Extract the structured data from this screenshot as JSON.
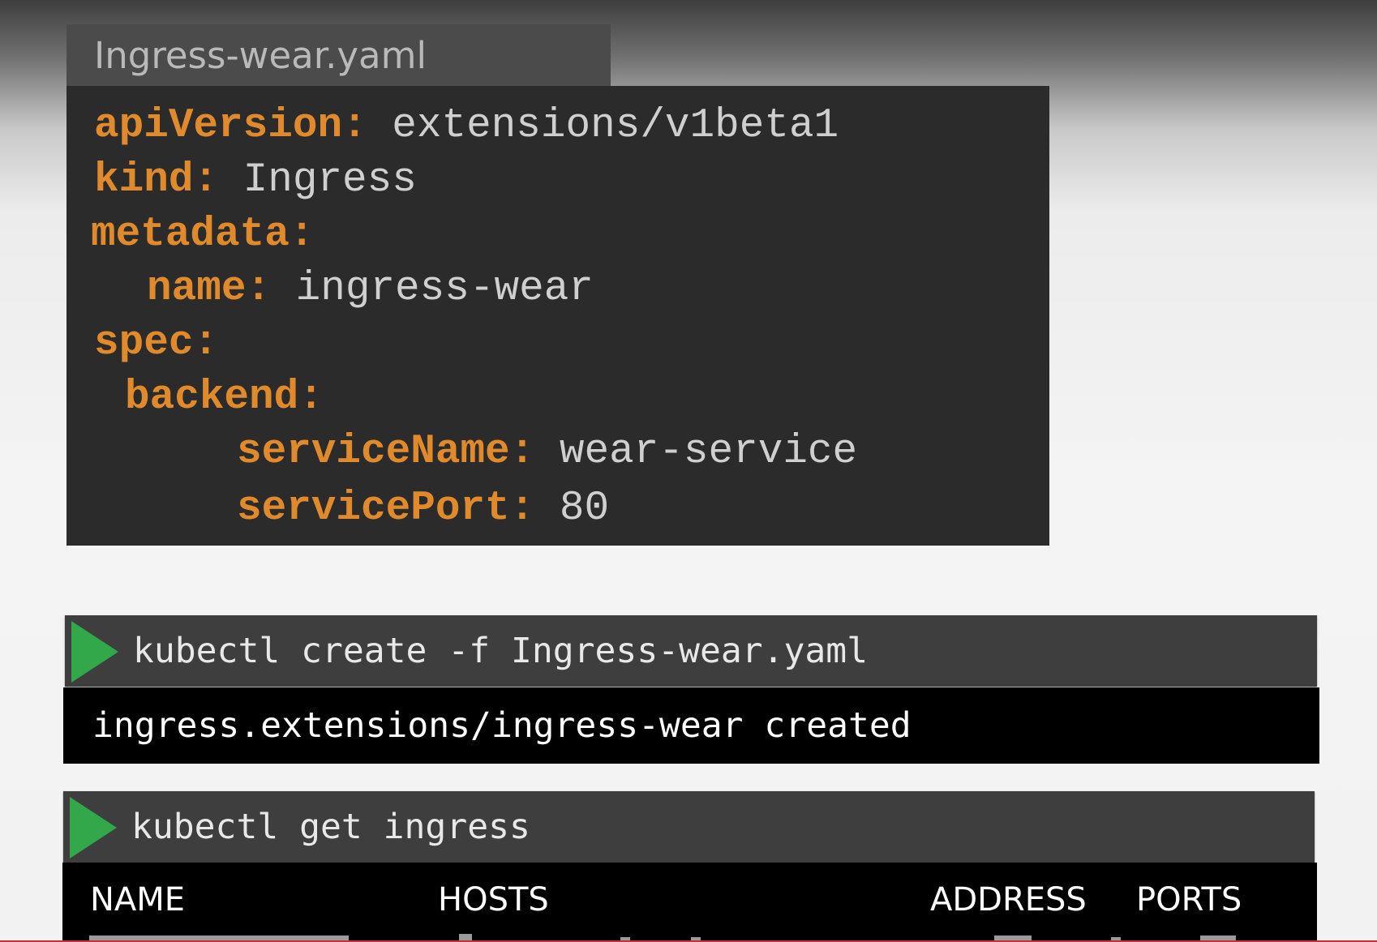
{
  "file_tab": {
    "filename": "Ingress-wear.yaml"
  },
  "yaml": {
    "lines": [
      {
        "key": "apiVersion:",
        "value": "extensions/v1beta1"
      },
      {
        "key": "kind:",
        "value": "Ingress"
      },
      {
        "key": "metadata:",
        "value": ""
      },
      {
        "key": "name:",
        "value": "ingress-wear"
      },
      {
        "key": "spec:",
        "value": ""
      },
      {
        "key": "backend:",
        "value": ""
      },
      {
        "key": "serviceName:",
        "value": "wear-service"
      },
      {
        "key": "servicePort:",
        "value": "80"
      }
    ]
  },
  "terminal1": {
    "command": "kubectl create -f Ingress-wear.yaml",
    "output": "ingress.extensions/ingress-wear created"
  },
  "terminal2": {
    "command": "kubectl get ingress",
    "columns": [
      "NAME",
      "HOSTS",
      "ADDRESS",
      "PORTS"
    ]
  },
  "colors": {
    "yaml_key": "#e08a2c",
    "yaml_value": "#cfcfcf",
    "play_icon": "#32a84a",
    "code_bg": "#2b2b2b",
    "terminal_bg": "#000000",
    "command_bar_bg": "#3e3e3e"
  }
}
